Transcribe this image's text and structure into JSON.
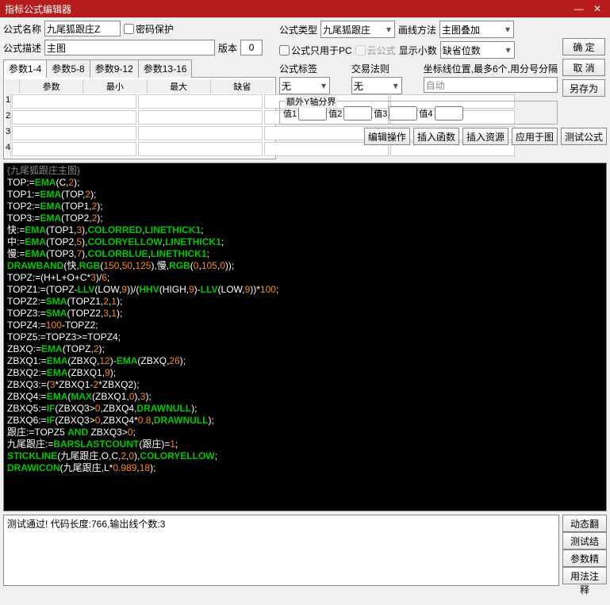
{
  "window": {
    "title": "指标公式编辑器"
  },
  "form": {
    "name_label": "公式名称",
    "name_value": "九尾狐跟庄Z",
    "protect_label": "密码保护",
    "desc_label": "公式描述",
    "desc_value": "主图",
    "version_label": "版本",
    "version_value": "0",
    "type_label": "公式类型",
    "type_value": "九尾狐跟庄",
    "draw_label": "画线方法",
    "draw_value": "主图叠加",
    "pconly_label": "公式只用于PC",
    "cloud_label": "云公式",
    "decimal_label": "显示小数",
    "decimal_value": "缺省位数",
    "tag_label": "公式标签",
    "tag_value": "无",
    "law_label": "交易法则",
    "law_value": "无",
    "coord_label": "坐标线位置,最多6个,用分号分隔",
    "coord_value": "自动",
    "extray_label": "额外Y轴分界",
    "val_labels": [
      "值1",
      "值2",
      "值3",
      "值4"
    ]
  },
  "buttons": {
    "ok": "确 定",
    "cancel": "取 消",
    "saveas": "另存为",
    "editop": "编辑操作",
    "insfunc": "插入函数",
    "insres": "插入资源",
    "applyimg": "应用于图",
    "test": "测试公式",
    "dyntrans": "动态翻译",
    "testres": "测试结果",
    "paramwiz": "参数精灵",
    "usage": "用法注释"
  },
  "tabs": [
    "参数1-4",
    "参数5-8",
    "参数9-12",
    "参数13-16"
  ],
  "param_headers": {
    "p": "参数",
    "min": "最小",
    "max": "最大",
    "def": "缺省"
  },
  "param_row_nums": [
    "1",
    "2",
    "3",
    "4"
  ],
  "status": "测试通过! 代码长度:766,输出线个数:3",
  "code_header": "{九尾狐跟庄主图}",
  "chart_data": null,
  "code": {
    "l1": {
      "a": "TOP:=",
      "b": "EMA",
      "c": "(C,",
      "d": "2",
      "e": ");"
    },
    "l2": {
      "a": "TOP1:=",
      "b": "EMA",
      "c": "(TOP,",
      "d": "2",
      "e": ");"
    },
    "l3": {
      "a": "TOP2:=",
      "b": "EMA",
      "c": "(TOP1,",
      "d": "2",
      "e": ");"
    },
    "l4": {
      "a": "TOP3:=",
      "b": "EMA",
      "c": "(TOP2,",
      "d": "2",
      "e": ");"
    },
    "l5": {
      "a": "快:=",
      "b": "EMA",
      "c": "(TOP1,",
      "d": "3",
      "e": "),",
      "f": "COLORRED",
      "g": ",",
      "h": "LINETHICK1",
      "i": ";"
    },
    "l6": {
      "a": "中:=",
      "b": "EMA",
      "c": "(TOP2,",
      "d": "5",
      "e": "),",
      "f": "COLORYELLOW",
      "g": ",",
      "h": "LINETHICK1",
      "i": ";"
    },
    "l7": {
      "a": "慢:=",
      "b": "EMA",
      "c": "(TOP3,",
      "d": "7",
      "e": "),",
      "f": "COLORBLUE",
      "g": ",",
      "h": "LINETHICK1",
      "i": ";"
    },
    "l8": {
      "a": "DRAWBAND",
      "b": "(快,",
      "c": "RGB",
      "d": "(",
      "e": "150",
      "f": ",",
      "g": "50",
      "h": ",",
      "i": "125",
      "j": "),慢,",
      "k": "RGB",
      "l": "(",
      "m": "0",
      "n": ",",
      "o": "105",
      "p": ",",
      "q": "0",
      "r": "));"
    },
    "l9": {
      "a": "TOPZ:=(H+L+O+C*",
      "b": "3",
      "c": ")/",
      "d": "6",
      "e": ";"
    },
    "l10": {
      "a": "TOPZ1:=(TOPZ-",
      "b": "LLV",
      "c": "(LOW,",
      "d": "9",
      "e": "))/(",
      "f": "HHV",
      "g": "(HIGH,",
      "h": "9",
      "i": ")-",
      "j": "LLV",
      "k": "(LOW,",
      "l": "9",
      "m": "))*",
      "n": "100",
      "o": ";"
    },
    "l11": {
      "a": "TOPZ2:=",
      "b": "SMA",
      "c": "(TOPZ1,",
      "d": "2",
      "e": ",",
      "f": "1",
      "g": ");"
    },
    "l12": {
      "a": "TOPZ3:=",
      "b": "SMA",
      "c": "(TOPZ2,",
      "d": "3",
      "e": ",",
      "f": "1",
      "g": ");"
    },
    "l13": {
      "a": "TOPZ4:=",
      "b": "100",
      "c": "-TOPZ2;"
    },
    "l14": {
      "a": "TOPZ5:=TOPZ3>=TOPZ4;"
    },
    "l15": {
      "a": "ZBXQ:=",
      "b": "EMA",
      "c": "(TOPZ,",
      "d": "2",
      "e": ");"
    },
    "l16": {
      "a": "ZBXQ1:=",
      "b": "EMA",
      "c": "(ZBXQ,",
      "d": "12",
      "e": ")-",
      "f": "EMA",
      "g": "(ZBXQ,",
      "h": "26",
      "i": ");"
    },
    "l17": {
      "a": "ZBXQ2:=",
      "b": "EMA",
      "c": "(ZBXQ1,",
      "d": "9",
      "e": ");"
    },
    "l18": {
      "a": "ZBXQ3:=(",
      "b": "3",
      "c": "*ZBXQ1-",
      "d": "2",
      "e": "*ZBXQ2);"
    },
    "l19": {
      "a": "ZBXQ4:=",
      "b": "EMA",
      "c": "(",
      "d": "MAX",
      "e": "(ZBXQ1,",
      "f": "0",
      "g": "),",
      "h": "3",
      "i": ");"
    },
    "l20": {
      "a": "ZBXQ5:=",
      "b": "IF",
      "c": "(ZBXQ3>",
      "d": "0",
      "e": ",ZBXQ4,",
      "f": "DRAWNULL",
      "g": ");"
    },
    "l21": {
      "a": "ZBXQ6:=",
      "b": "IF",
      "c": "(ZBXQ3>",
      "d": "0",
      "e": ",ZBXQ4*",
      "f": "0.8",
      "g": ",",
      "h": "DRAWNULL",
      "i": ");"
    },
    "l22": {
      "a": "跟庄:=TOPZ5 ",
      "b": "AND",
      "c": " ZBXQ3>",
      "d": "0",
      "e": ";"
    },
    "l23": {
      "a": "九尾跟庄:=",
      "b": "BARSLASTCOUNT",
      "c": "(跟庄)=",
      "d": "1",
      "e": ";"
    },
    "l24": {
      "a": "STICKLINE",
      "b": "(九尾跟庄,O,C,",
      "c": "2",
      "d": ",",
      "e": "0",
      "f": "),",
      "g": "COLORYELLOW",
      "h": ";"
    },
    "l25": {
      "a": "DRAWICON",
      "b": "(九尾跟庄,L*",
      "c": "0.989",
      "d": ",",
      "e": "18",
      "f": ");"
    }
  }
}
